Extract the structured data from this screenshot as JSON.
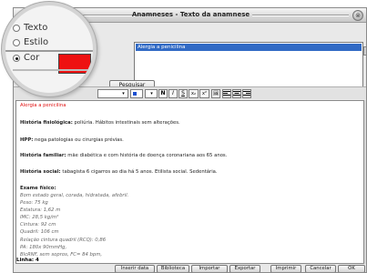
{
  "window": {
    "title": "Anamneses - Texto da anamnese",
    "close": "⊗"
  },
  "search": {
    "results": [
      "Alergia a penicilina"
    ],
    "button": "Pesquisar"
  },
  "magnifier": {
    "options": [
      {
        "label": "Texto",
        "selected": false
      },
      {
        "label": "Estilo",
        "selected": false
      },
      {
        "label": "Cor",
        "selected": true
      }
    ],
    "swatch_color": "#ee1111"
  },
  "toolbar": {
    "bold": "N",
    "italic": "I",
    "underline": "S",
    "subscript": "x₂",
    "superscript": "x²",
    "image": "🖼",
    "dropdown": "▾"
  },
  "editor": {
    "heading": "Alergia a penicilina",
    "paragraphs": [
      {
        "label": "História fisiológica:",
        "text": " poliúria. Hábitos intestinais sem alterações."
      },
      {
        "label": "HPP:",
        "text": " nega patologias ou cirurgias prévias."
      },
      {
        "label": "História familiar:",
        "text": " mãe diabética e com história de doença coronariana aos 65 anos."
      },
      {
        "label": "História social:",
        "text": " tabagista 6 cigarros ao dia há 5 anos. Etilista social. Sedentária."
      }
    ],
    "exam_title": "Exame físico:",
    "exam_lines": [
      "Bom estado geral, corada, hidratada, afebril.",
      "Peso: 75 kg",
      "Estatura: 1,62 m",
      "IMC: 28,5 kg/m²",
      "Cintura: 92 cm",
      "Quadril: 106 cm",
      "Relação cintura quadril (RCQ): 0,86",
      "PA: 180x 90mmHg,",
      "BIcRNF, sem sopros, FC= 84 bpm,"
    ]
  },
  "status": {
    "line_label": "Linha: 4"
  },
  "buttons": {
    "insert_date": "Inserir data",
    "library": "Biblioteca",
    "import_text": "Importar texto",
    "export": "Exportar",
    "print": "Imprimir",
    "cancel": "Cancelar",
    "ok": "OK"
  }
}
